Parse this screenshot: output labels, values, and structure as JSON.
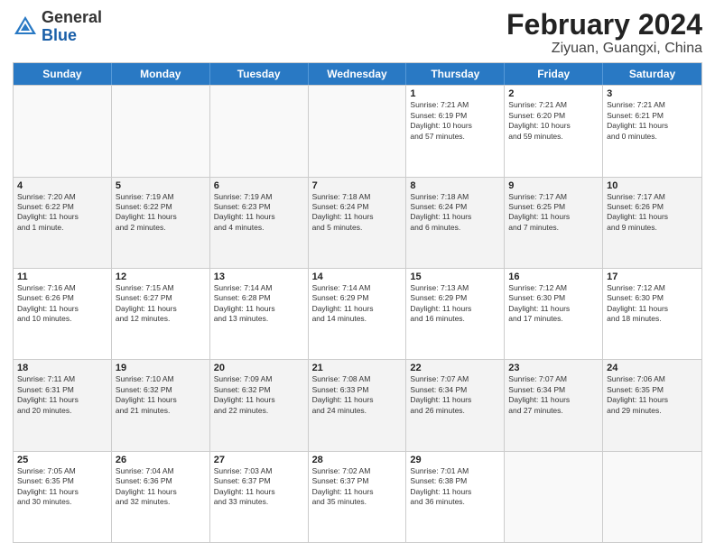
{
  "header": {
    "logo_general": "General",
    "logo_blue": "Blue",
    "month_year": "February 2024",
    "location": "Ziyuan, Guangxi, China"
  },
  "days_of_week": [
    "Sunday",
    "Monday",
    "Tuesday",
    "Wednesday",
    "Thursday",
    "Friday",
    "Saturday"
  ],
  "rows": [
    {
      "alt": false,
      "cells": [
        {
          "day": "",
          "empty": true,
          "text": ""
        },
        {
          "day": "",
          "empty": true,
          "text": ""
        },
        {
          "day": "",
          "empty": true,
          "text": ""
        },
        {
          "day": "",
          "empty": true,
          "text": ""
        },
        {
          "day": "1",
          "empty": false,
          "text": "Sunrise: 7:21 AM\nSunset: 6:19 PM\nDaylight: 10 hours\nand 57 minutes."
        },
        {
          "day": "2",
          "empty": false,
          "text": "Sunrise: 7:21 AM\nSunset: 6:20 PM\nDaylight: 10 hours\nand 59 minutes."
        },
        {
          "day": "3",
          "empty": false,
          "text": "Sunrise: 7:21 AM\nSunset: 6:21 PM\nDaylight: 11 hours\nand 0 minutes."
        }
      ]
    },
    {
      "alt": true,
      "cells": [
        {
          "day": "4",
          "empty": false,
          "text": "Sunrise: 7:20 AM\nSunset: 6:22 PM\nDaylight: 11 hours\nand 1 minute."
        },
        {
          "day": "5",
          "empty": false,
          "text": "Sunrise: 7:19 AM\nSunset: 6:22 PM\nDaylight: 11 hours\nand 2 minutes."
        },
        {
          "day": "6",
          "empty": false,
          "text": "Sunrise: 7:19 AM\nSunset: 6:23 PM\nDaylight: 11 hours\nand 4 minutes."
        },
        {
          "day": "7",
          "empty": false,
          "text": "Sunrise: 7:18 AM\nSunset: 6:24 PM\nDaylight: 11 hours\nand 5 minutes."
        },
        {
          "day": "8",
          "empty": false,
          "text": "Sunrise: 7:18 AM\nSunset: 6:24 PM\nDaylight: 11 hours\nand 6 minutes."
        },
        {
          "day": "9",
          "empty": false,
          "text": "Sunrise: 7:17 AM\nSunset: 6:25 PM\nDaylight: 11 hours\nand 7 minutes."
        },
        {
          "day": "10",
          "empty": false,
          "text": "Sunrise: 7:17 AM\nSunset: 6:26 PM\nDaylight: 11 hours\nand 9 minutes."
        }
      ]
    },
    {
      "alt": false,
      "cells": [
        {
          "day": "11",
          "empty": false,
          "text": "Sunrise: 7:16 AM\nSunset: 6:26 PM\nDaylight: 11 hours\nand 10 minutes."
        },
        {
          "day": "12",
          "empty": false,
          "text": "Sunrise: 7:15 AM\nSunset: 6:27 PM\nDaylight: 11 hours\nand 12 minutes."
        },
        {
          "day": "13",
          "empty": false,
          "text": "Sunrise: 7:14 AM\nSunset: 6:28 PM\nDaylight: 11 hours\nand 13 minutes."
        },
        {
          "day": "14",
          "empty": false,
          "text": "Sunrise: 7:14 AM\nSunset: 6:29 PM\nDaylight: 11 hours\nand 14 minutes."
        },
        {
          "day": "15",
          "empty": false,
          "text": "Sunrise: 7:13 AM\nSunset: 6:29 PM\nDaylight: 11 hours\nand 16 minutes."
        },
        {
          "day": "16",
          "empty": false,
          "text": "Sunrise: 7:12 AM\nSunset: 6:30 PM\nDaylight: 11 hours\nand 17 minutes."
        },
        {
          "day": "17",
          "empty": false,
          "text": "Sunrise: 7:12 AM\nSunset: 6:30 PM\nDaylight: 11 hours\nand 18 minutes."
        }
      ]
    },
    {
      "alt": true,
      "cells": [
        {
          "day": "18",
          "empty": false,
          "text": "Sunrise: 7:11 AM\nSunset: 6:31 PM\nDaylight: 11 hours\nand 20 minutes."
        },
        {
          "day": "19",
          "empty": false,
          "text": "Sunrise: 7:10 AM\nSunset: 6:32 PM\nDaylight: 11 hours\nand 21 minutes."
        },
        {
          "day": "20",
          "empty": false,
          "text": "Sunrise: 7:09 AM\nSunset: 6:32 PM\nDaylight: 11 hours\nand 22 minutes."
        },
        {
          "day": "21",
          "empty": false,
          "text": "Sunrise: 7:08 AM\nSunset: 6:33 PM\nDaylight: 11 hours\nand 24 minutes."
        },
        {
          "day": "22",
          "empty": false,
          "text": "Sunrise: 7:07 AM\nSunset: 6:34 PM\nDaylight: 11 hours\nand 26 minutes."
        },
        {
          "day": "23",
          "empty": false,
          "text": "Sunrise: 7:07 AM\nSunset: 6:34 PM\nDaylight: 11 hours\nand 27 minutes."
        },
        {
          "day": "24",
          "empty": false,
          "text": "Sunrise: 7:06 AM\nSunset: 6:35 PM\nDaylight: 11 hours\nand 29 minutes."
        }
      ]
    },
    {
      "alt": false,
      "cells": [
        {
          "day": "25",
          "empty": false,
          "text": "Sunrise: 7:05 AM\nSunset: 6:35 PM\nDaylight: 11 hours\nand 30 minutes."
        },
        {
          "day": "26",
          "empty": false,
          "text": "Sunrise: 7:04 AM\nSunset: 6:36 PM\nDaylight: 11 hours\nand 32 minutes."
        },
        {
          "day": "27",
          "empty": false,
          "text": "Sunrise: 7:03 AM\nSunset: 6:37 PM\nDaylight: 11 hours\nand 33 minutes."
        },
        {
          "day": "28",
          "empty": false,
          "text": "Sunrise: 7:02 AM\nSunset: 6:37 PM\nDaylight: 11 hours\nand 35 minutes."
        },
        {
          "day": "29",
          "empty": false,
          "text": "Sunrise: 7:01 AM\nSunset: 6:38 PM\nDaylight: 11 hours\nand 36 minutes."
        },
        {
          "day": "",
          "empty": true,
          "text": ""
        },
        {
          "day": "",
          "empty": true,
          "text": ""
        }
      ]
    }
  ]
}
